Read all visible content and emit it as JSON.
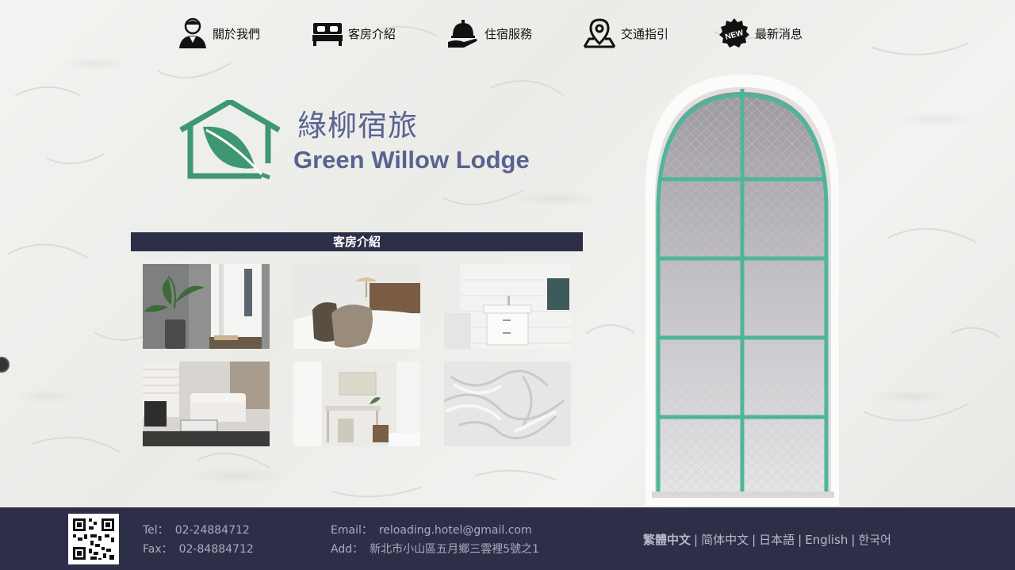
{
  "nav": {
    "items": [
      {
        "label": "關於我們",
        "icon": "staff-person-icon"
      },
      {
        "label": "客房介紹",
        "icon": "bed-icon"
      },
      {
        "label": "住宿服務",
        "icon": "service-bell-icon"
      },
      {
        "label": "交通指引",
        "icon": "map-pin-icon"
      },
      {
        "label": "最新消息",
        "icon": "new-badge-icon",
        "badge_text": "NEW"
      }
    ]
  },
  "logo": {
    "name_zh": "綠柳宿旅",
    "name_en": "Green Willow Lodge",
    "icon": "house-leaf-icon",
    "brand_color": "#3e9770",
    "text_color": "#5a6291"
  },
  "section": {
    "title": "客房介紹",
    "gallery": [
      {
        "icon": "room-plant-photo"
      },
      {
        "icon": "bed-pillows-photo"
      },
      {
        "icon": "bathroom-sink-photo"
      },
      {
        "icon": "living-room-sofa-photo"
      },
      {
        "icon": "desk-corner-photo"
      },
      {
        "icon": "white-sheets-photo"
      }
    ]
  },
  "footer": {
    "tel_label": "Tel：",
    "tel": "02-24884712",
    "fax_label": "Fax：",
    "fax": "02-84884712",
    "email_label": "Email：",
    "email": "reloading.hotel@gmail.com",
    "address_label": "Add：",
    "address": "新北市小山區五月鄉三雲裡5號之1",
    "languages": [
      "繁體中文",
      "简体中文",
      "日本語",
      "English",
      "한국어"
    ],
    "separator": "|"
  },
  "colors": {
    "footer_bg": "#2d2f48",
    "section_bar_bg": "#2d2f48",
    "window_frame": "#4fb59a"
  }
}
